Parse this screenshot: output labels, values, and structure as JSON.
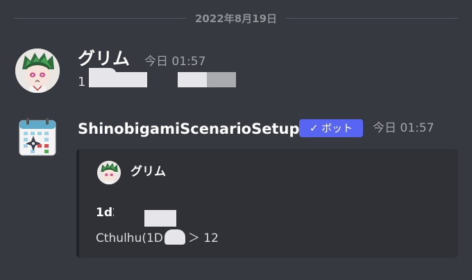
{
  "date_divider": {
    "text": "2022年8月19日"
  },
  "message1": {
    "author": "グリム",
    "timestamp": "今日 01:57",
    "content_visible": "1"
  },
  "message2": {
    "author": "ShinobigamiScenarioSetup",
    "bot_tag": "✓ ボット",
    "timestamp": "今日 01:57",
    "embed": {
      "author": "グリム",
      "line1_visible": "1d2",
      "line2_left": "Cthulhu(1D",
      "line2_right": "＞ 12"
    }
  },
  "colors": {
    "background": "#36393f",
    "embed_background": "#2f3136",
    "bot_tag": "#5865f2",
    "timestamp": "#a3a6aa"
  },
  "icons": {
    "message1_avatar": "anime-character-avatar",
    "message2_avatar": "calendar-shuriken-app-icon",
    "bot_check": "check-icon"
  }
}
